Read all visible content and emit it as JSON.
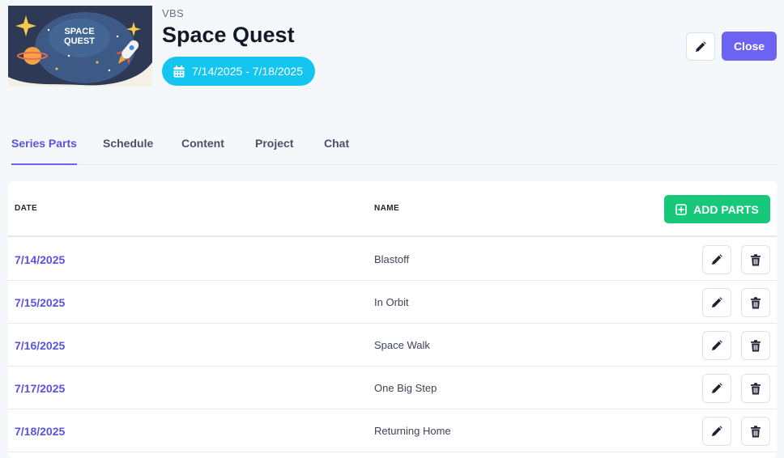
{
  "header": {
    "category": "VBS",
    "title": "Space Quest",
    "date_range": "7/14/2025 - 7/18/2025",
    "close_label": "Close",
    "thumbnail": {
      "line1": "SPACE",
      "line2": "QUEST"
    }
  },
  "tabs": [
    {
      "label": "Series Parts",
      "active": true
    },
    {
      "label": "Schedule",
      "active": false
    },
    {
      "label": "Content",
      "active": false
    },
    {
      "label": "Project",
      "active": false
    },
    {
      "label": "Chat",
      "active": false
    }
  ],
  "table": {
    "columns": [
      "DATE",
      "NAME"
    ],
    "add_label": "ADD PARTS",
    "rows": [
      {
        "date": "7/14/2025",
        "name": "Blastoff"
      },
      {
        "date": "7/15/2025",
        "name": "In Orbit"
      },
      {
        "date": "7/16/2025",
        "name": "Space Walk"
      },
      {
        "date": "7/17/2025",
        "name": "One Big Step"
      },
      {
        "date": "7/18/2025",
        "name": "Returning Home"
      }
    ]
  },
  "colors": {
    "accent": "#6c63f3",
    "date_pill": "#14c6ef",
    "add_button": "#17c87a"
  },
  "icons": {
    "edit": "pencil-icon",
    "delete": "trash-icon",
    "add": "plus-square-icon",
    "calendar": "calendar-icon"
  }
}
